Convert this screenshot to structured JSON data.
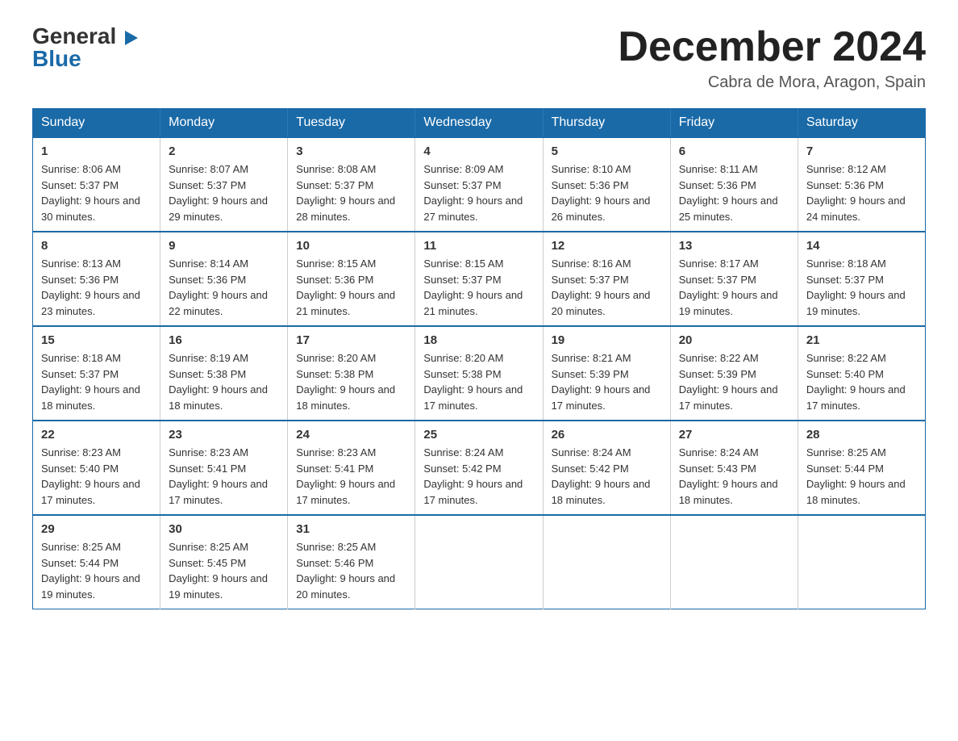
{
  "logo": {
    "line1": "General",
    "arrow": "▶",
    "line2": "Blue"
  },
  "title": {
    "month": "December 2024",
    "location": "Cabra de Mora, Aragon, Spain"
  },
  "days_of_week": [
    "Sunday",
    "Monday",
    "Tuesday",
    "Wednesday",
    "Thursday",
    "Friday",
    "Saturday"
  ],
  "weeks": [
    [
      {
        "day": "1",
        "sunrise": "8:06 AM",
        "sunset": "5:37 PM",
        "daylight": "9 hours and 30 minutes."
      },
      {
        "day": "2",
        "sunrise": "8:07 AM",
        "sunset": "5:37 PM",
        "daylight": "9 hours and 29 minutes."
      },
      {
        "day": "3",
        "sunrise": "8:08 AM",
        "sunset": "5:37 PM",
        "daylight": "9 hours and 28 minutes."
      },
      {
        "day": "4",
        "sunrise": "8:09 AM",
        "sunset": "5:37 PM",
        "daylight": "9 hours and 27 minutes."
      },
      {
        "day": "5",
        "sunrise": "8:10 AM",
        "sunset": "5:36 PM",
        "daylight": "9 hours and 26 minutes."
      },
      {
        "day": "6",
        "sunrise": "8:11 AM",
        "sunset": "5:36 PM",
        "daylight": "9 hours and 25 minutes."
      },
      {
        "day": "7",
        "sunrise": "8:12 AM",
        "sunset": "5:36 PM",
        "daylight": "9 hours and 24 minutes."
      }
    ],
    [
      {
        "day": "8",
        "sunrise": "8:13 AM",
        "sunset": "5:36 PM",
        "daylight": "9 hours and 23 minutes."
      },
      {
        "day": "9",
        "sunrise": "8:14 AM",
        "sunset": "5:36 PM",
        "daylight": "9 hours and 22 minutes."
      },
      {
        "day": "10",
        "sunrise": "8:15 AM",
        "sunset": "5:36 PM",
        "daylight": "9 hours and 21 minutes."
      },
      {
        "day": "11",
        "sunrise": "8:15 AM",
        "sunset": "5:37 PM",
        "daylight": "9 hours and 21 minutes."
      },
      {
        "day": "12",
        "sunrise": "8:16 AM",
        "sunset": "5:37 PM",
        "daylight": "9 hours and 20 minutes."
      },
      {
        "day": "13",
        "sunrise": "8:17 AM",
        "sunset": "5:37 PM",
        "daylight": "9 hours and 19 minutes."
      },
      {
        "day": "14",
        "sunrise": "8:18 AM",
        "sunset": "5:37 PM",
        "daylight": "9 hours and 19 minutes."
      }
    ],
    [
      {
        "day": "15",
        "sunrise": "8:18 AM",
        "sunset": "5:37 PM",
        "daylight": "9 hours and 18 minutes."
      },
      {
        "day": "16",
        "sunrise": "8:19 AM",
        "sunset": "5:38 PM",
        "daylight": "9 hours and 18 minutes."
      },
      {
        "day": "17",
        "sunrise": "8:20 AM",
        "sunset": "5:38 PM",
        "daylight": "9 hours and 18 minutes."
      },
      {
        "day": "18",
        "sunrise": "8:20 AM",
        "sunset": "5:38 PM",
        "daylight": "9 hours and 17 minutes."
      },
      {
        "day": "19",
        "sunrise": "8:21 AM",
        "sunset": "5:39 PM",
        "daylight": "9 hours and 17 minutes."
      },
      {
        "day": "20",
        "sunrise": "8:22 AM",
        "sunset": "5:39 PM",
        "daylight": "9 hours and 17 minutes."
      },
      {
        "day": "21",
        "sunrise": "8:22 AM",
        "sunset": "5:40 PM",
        "daylight": "9 hours and 17 minutes."
      }
    ],
    [
      {
        "day": "22",
        "sunrise": "8:23 AM",
        "sunset": "5:40 PM",
        "daylight": "9 hours and 17 minutes."
      },
      {
        "day": "23",
        "sunrise": "8:23 AM",
        "sunset": "5:41 PM",
        "daylight": "9 hours and 17 minutes."
      },
      {
        "day": "24",
        "sunrise": "8:23 AM",
        "sunset": "5:41 PM",
        "daylight": "9 hours and 17 minutes."
      },
      {
        "day": "25",
        "sunrise": "8:24 AM",
        "sunset": "5:42 PM",
        "daylight": "9 hours and 17 minutes."
      },
      {
        "day": "26",
        "sunrise": "8:24 AM",
        "sunset": "5:42 PM",
        "daylight": "9 hours and 18 minutes."
      },
      {
        "day": "27",
        "sunrise": "8:24 AM",
        "sunset": "5:43 PM",
        "daylight": "9 hours and 18 minutes."
      },
      {
        "day": "28",
        "sunrise": "8:25 AM",
        "sunset": "5:44 PM",
        "daylight": "9 hours and 18 minutes."
      }
    ],
    [
      {
        "day": "29",
        "sunrise": "8:25 AM",
        "sunset": "5:44 PM",
        "daylight": "9 hours and 19 minutes."
      },
      {
        "day": "30",
        "sunrise": "8:25 AM",
        "sunset": "5:45 PM",
        "daylight": "9 hours and 19 minutes."
      },
      {
        "day": "31",
        "sunrise": "8:25 AM",
        "sunset": "5:46 PM",
        "daylight": "9 hours and 20 minutes."
      },
      {
        "day": "",
        "sunrise": "",
        "sunset": "",
        "daylight": ""
      },
      {
        "day": "",
        "sunrise": "",
        "sunset": "",
        "daylight": ""
      },
      {
        "day": "",
        "sunrise": "",
        "sunset": "",
        "daylight": ""
      },
      {
        "day": "",
        "sunrise": "",
        "sunset": "",
        "daylight": ""
      }
    ]
  ]
}
